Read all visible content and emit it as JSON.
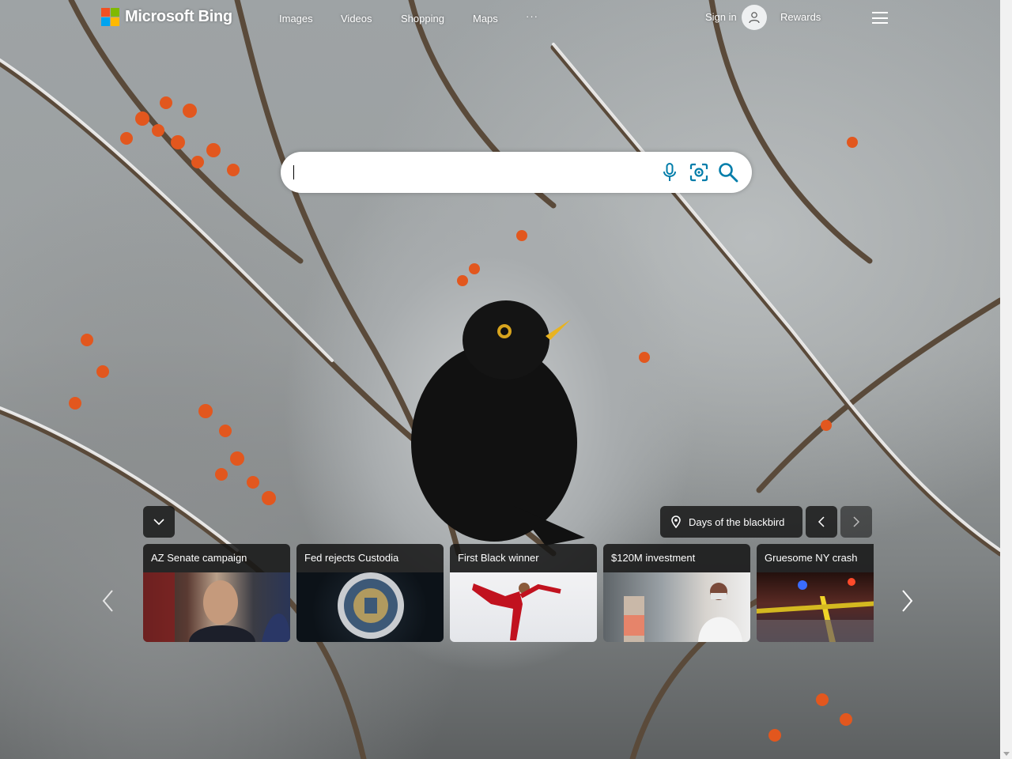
{
  "header": {
    "logo_text": "Microsoft Bing",
    "nav": [
      "Images",
      "Videos",
      "Shopping",
      "Maps"
    ],
    "more_label": "···",
    "signin_label": "Sign in",
    "rewards_label": "Rewards"
  },
  "search": {
    "value": "",
    "placeholder": ""
  },
  "background": {
    "caption": "Days of the blackbird"
  },
  "news_cards": [
    {
      "title": "AZ Senate campaign"
    },
    {
      "title": "Fed rejects Custodia"
    },
    {
      "title": "First Black winner"
    },
    {
      "title": "$120M investment"
    },
    {
      "title": "Gruesome NY crash"
    }
  ],
  "colors": {
    "accent": "#007daa",
    "card_bar": "#141414"
  },
  "icons": {
    "microphone": "microphone-icon",
    "visual_search": "visual-search-icon",
    "search": "search-icon",
    "location": "location-pin-icon",
    "menu": "hamburger-menu-icon"
  }
}
